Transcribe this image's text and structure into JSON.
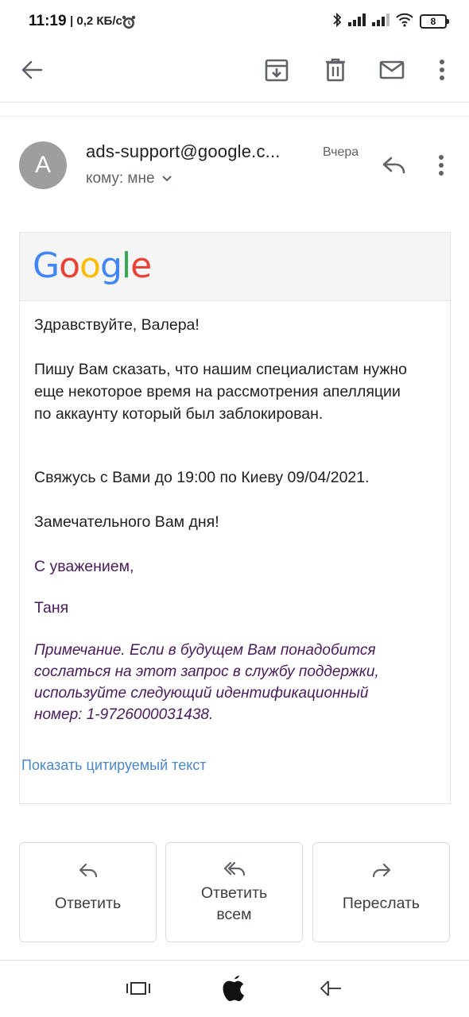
{
  "status_bar": {
    "time": "11:19",
    "speed": "0,2 КБ/с",
    "battery": "8",
    "icons": [
      "alarm-icon",
      "bluetooth-icon",
      "signal-icon",
      "signal-icon",
      "wifi-icon",
      "battery-icon"
    ]
  },
  "toolbar": {
    "icons": [
      "back-arrow-icon",
      "archive-icon",
      "delete-icon",
      "mark-unread-icon",
      "more-vert-icon"
    ]
  },
  "header": {
    "avatar_letter": "A",
    "sender": "ads-support@google.c...",
    "date": "Вчера",
    "to": "кому: мне"
  },
  "message": {
    "logo": [
      "G",
      "o",
      "o",
      "g",
      "l",
      "e"
    ],
    "logo_colors": [
      "#4285F4",
      "#EA4335",
      "#FBBC05",
      "#4285F4",
      "#34A853",
      "#EA4335"
    ],
    "greeting": "Здравствуйте, Валера!",
    "paragraph1": "Пишу Вам сказать, что нашим специалистам нужно еще некоторое время на рассмотрения апелляции по аккаунту который был заблокирован.",
    "paragraph2": "Свяжусь с Вами до 19:00 по Киеву 09/04/2021.",
    "paragraph3": "Замечательного Вам дня!",
    "signoff": "С уважением,",
    "signature": "Таня",
    "note": "Примечание. Если в будущем Вам понадобится сослаться на этот запрос в службу поддержки, используйте следующий идентификационный номер: 1-9726000031438.",
    "show_quoted": "Показать цитируемый текст"
  },
  "actions": {
    "reply": "Ответить",
    "reply_all_line1": "Ответить",
    "reply_all_line2": "всем",
    "forward": "Переслать"
  },
  "nav": {
    "icons": [
      "recents-icon",
      "home-apple-icon",
      "back-icon"
    ]
  }
}
